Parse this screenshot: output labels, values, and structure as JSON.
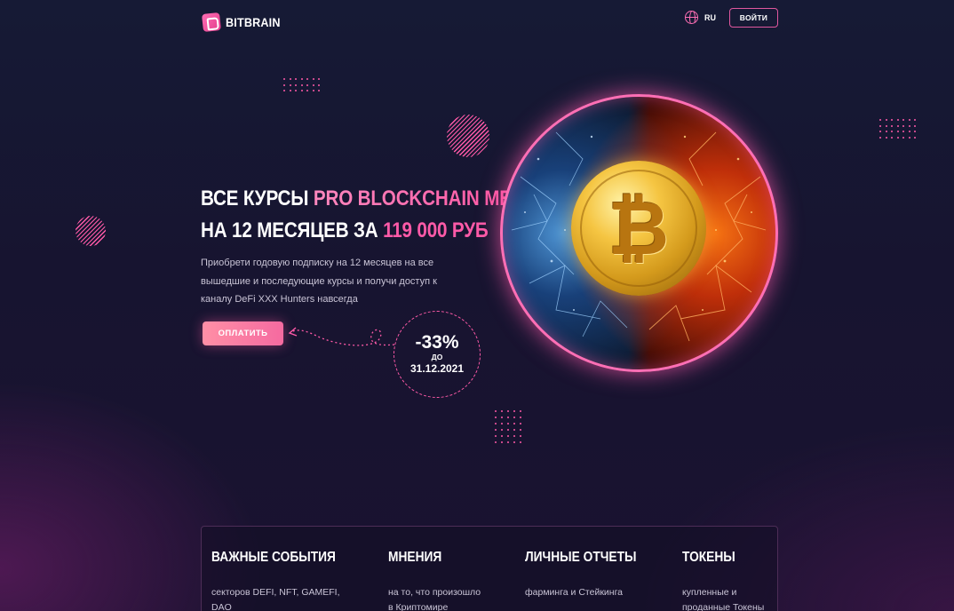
{
  "header": {
    "brand": "BITBRAIN",
    "lang": "RU",
    "login_label": "ВОЙТИ"
  },
  "hero": {
    "title_line1_white": "ВСЕ КУРСЫ",
    "title_line1_accent": "PRO BLOCKCHAIN MEDIA",
    "title_line2_white": "НА 12 МЕСЯЦЕВ ЗА",
    "title_line2_price": "119 000 РУБ",
    "description": "Приобрети годовую подписку на 12 месяцев на все вышедшие и последующие курсы и получи доступ к каналу DeFi XXX Hunters навсегда",
    "pay_label": "ОПЛАТИТЬ",
    "discount_percent": "-33%",
    "discount_until": "ДО",
    "discount_date": "31.12.2021"
  },
  "features": [
    {
      "title": "ВАЖНЫЕ СОБЫТИЯ",
      "line1": "секторов DEFI, NFT, GAMEFI,",
      "line2": "DAO"
    },
    {
      "title": "МНЕНИЯ",
      "line1": "на то, что произошло",
      "line2": "в Криптомире"
    },
    {
      "title": "ЛИЧНЫЕ ОТЧЕТЫ",
      "line1": "фарминга и Стейкинга",
      "line2": ""
    },
    {
      "title": "ТОКЕНЫ",
      "line1": "купленные и",
      "line2": "проданные Токены"
    }
  ],
  "icons": {
    "logo": "bitbrain-logo-icon",
    "language": "globe-icon",
    "coin": "bitcoin-icon",
    "arrow": "curved-arrow-icon"
  },
  "colors": {
    "accent": "#ff5aa8",
    "background": "#161a35",
    "button_gradient_start": "#ff8fa6",
    "button_gradient_end": "#f56aa0"
  }
}
